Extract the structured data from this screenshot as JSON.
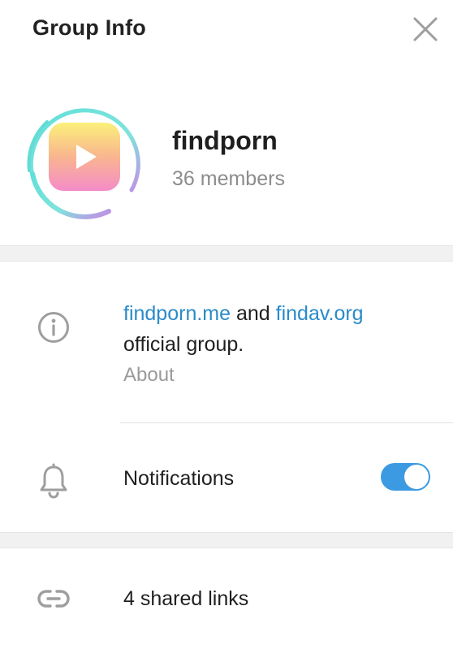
{
  "header": {
    "title": "Group Info",
    "close_icon": "close-icon"
  },
  "profile": {
    "name": "findporn",
    "members": "36 members",
    "avatar_icon": "play-icon"
  },
  "about": {
    "link1": "findporn.me",
    "connector": " and ",
    "link2": "findav.org",
    "line2": "official group.",
    "label": "About",
    "icon": "info-icon"
  },
  "notifications": {
    "label": "Notifications",
    "enabled": true,
    "icon": "bell-icon"
  },
  "shared_links": {
    "label": "4 shared links",
    "icon": "link-icon"
  },
  "colors": {
    "accent": "#3b9ae1",
    "link": "#2a8bc9",
    "muted": "#8c8c8c"
  }
}
